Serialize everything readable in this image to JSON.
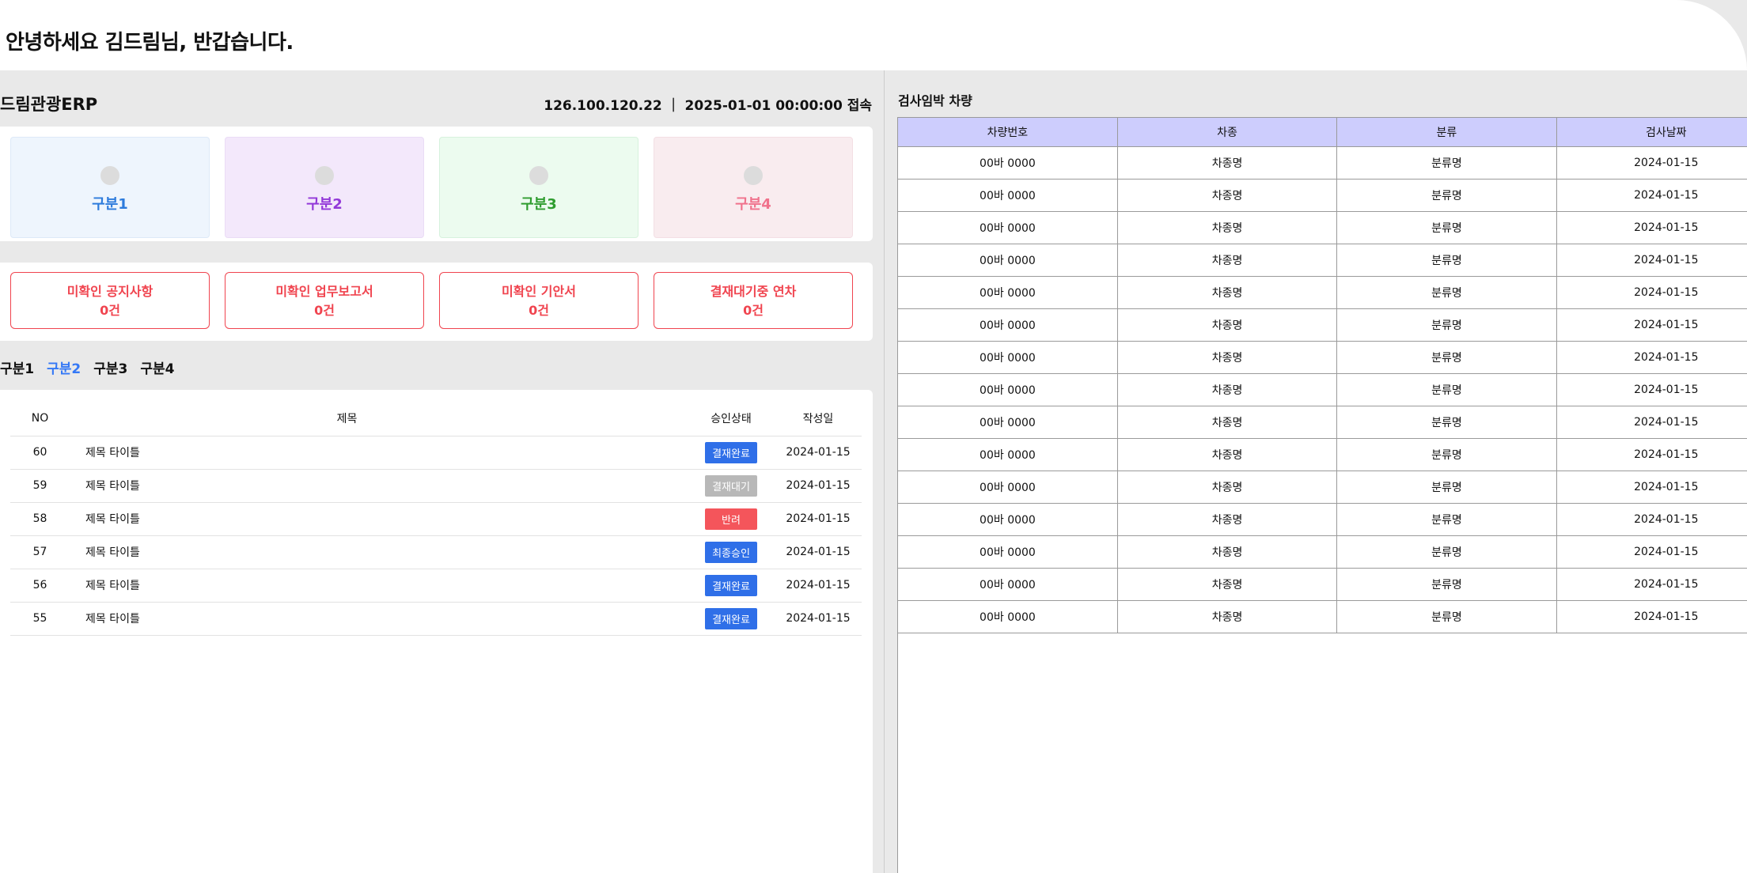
{
  "header": {
    "greeting": "안녕하세요 김드림님, 반갑습니다."
  },
  "left": {
    "erp_title": "드림관광ERP",
    "ip_info": "126.100.120.22 ｜ 2025-01-01 00:00:00 접속",
    "categories": [
      {
        "label": "구분1",
        "color": "#2d7bdc",
        "bg": "#eef5fd",
        "border": "#dde9f8"
      },
      {
        "label": "구분2",
        "color": "#9238d8",
        "bg": "#f3e8fb",
        "border": "#eadcf6"
      },
      {
        "label": "구분3",
        "color": "#2f9d2f",
        "bg": "#ecfbef",
        "border": "#d7f2dd"
      },
      {
        "label": "구분4",
        "color": "#f0728c",
        "bg": "#f9ecef",
        "border": "#f3dfe4"
      }
    ],
    "alerts": [
      {
        "label": "미확인 공지사항",
        "count": "0건"
      },
      {
        "label": "미확인 업무보고서",
        "count": "0건"
      },
      {
        "label": "미확인 기안서",
        "count": "0건"
      },
      {
        "label": "결재대기중 연차",
        "count": "0건"
      }
    ],
    "tabs": [
      {
        "label": "구분1",
        "active": false
      },
      {
        "label": "구분2",
        "active": true
      },
      {
        "label": "구분3",
        "active": false
      },
      {
        "label": "구분4",
        "active": false
      }
    ],
    "table": {
      "headers": {
        "no": "NO",
        "title": "제목",
        "status": "승인상태",
        "date": "작성일"
      },
      "rows": [
        {
          "no": "60",
          "title": "제목 타이틀",
          "status": "결재완료",
          "status_color": "#2f6fe8",
          "date": "2024-01-15"
        },
        {
          "no": "59",
          "title": "제목 타이틀",
          "status": "결재대기",
          "status_color": "#b8b8b8",
          "date": "2024-01-15"
        },
        {
          "no": "58",
          "title": "제목 타이틀",
          "status": "반려",
          "status_color": "#f4555b",
          "date": "2024-01-15"
        },
        {
          "no": "57",
          "title": "제목 타이틀",
          "status": "최종승인",
          "status_color": "#2f6fe8",
          "date": "2024-01-15"
        },
        {
          "no": "56",
          "title": "제목 타이틀",
          "status": "결재완료",
          "status_color": "#2f6fe8",
          "date": "2024-01-15"
        },
        {
          "no": "55",
          "title": "제목 타이틀",
          "status": "결재완료",
          "status_color": "#2f6fe8",
          "date": "2024-01-15"
        }
      ]
    }
  },
  "right": {
    "title": "검사임박 차량",
    "headers": [
      "차량번호",
      "차종",
      "분류",
      "검사날짜"
    ],
    "rows": [
      [
        "00바 0000",
        "차종명",
        "분류명",
        "2024-01-15"
      ],
      [
        "00바 0000",
        "차종명",
        "분류명",
        "2024-01-15"
      ],
      [
        "00바 0000",
        "차종명",
        "분류명",
        "2024-01-15"
      ],
      [
        "00바 0000",
        "차종명",
        "분류명",
        "2024-01-15"
      ],
      [
        "00바 0000",
        "차종명",
        "분류명",
        "2024-01-15"
      ],
      [
        "00바 0000",
        "차종명",
        "분류명",
        "2024-01-15"
      ],
      [
        "00바 0000",
        "차종명",
        "분류명",
        "2024-01-15"
      ],
      [
        "00바 0000",
        "차종명",
        "분류명",
        "2024-01-15"
      ],
      [
        "00바 0000",
        "차종명",
        "분류명",
        "2024-01-15"
      ],
      [
        "00바 0000",
        "차종명",
        "분류명",
        "2024-01-15"
      ],
      [
        "00바 0000",
        "차종명",
        "분류명",
        "2024-01-15"
      ],
      [
        "00바 0000",
        "차종명",
        "분류명",
        "2024-01-15"
      ],
      [
        "00바 0000",
        "차종명",
        "분류명",
        "2024-01-15"
      ],
      [
        "00바 0000",
        "차종명",
        "분류명",
        "2024-01-15"
      ],
      [
        "00바 0000",
        "차종명",
        "분류명",
        "2024-01-15"
      ]
    ]
  }
}
